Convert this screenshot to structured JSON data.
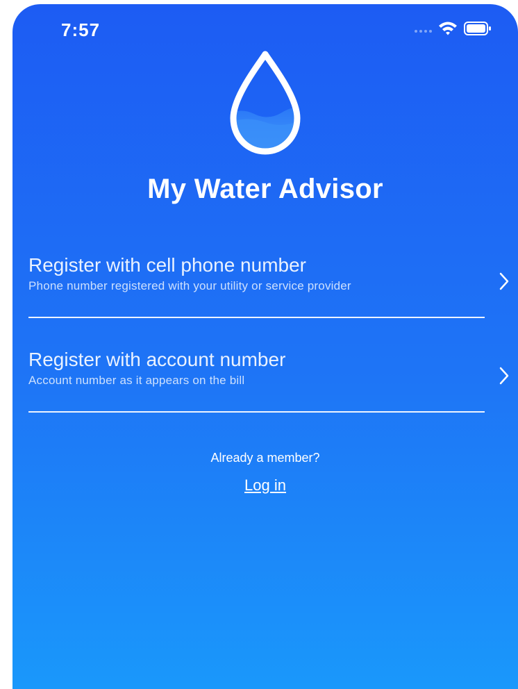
{
  "status_bar": {
    "time": "7:57",
    "icons": [
      "signal-dots-icon",
      "wifi-icon",
      "battery-icon"
    ]
  },
  "app": {
    "logo_icon": "water-drop-icon",
    "title": "My Water Advisor"
  },
  "options": [
    {
      "title": "Register with cell phone number",
      "subtitle": "Phone number registered with your utility or service provider",
      "icon": "chevron-right-icon"
    },
    {
      "title": "Register with account number",
      "subtitle": "Account number as it appears on the bill",
      "icon": "chevron-right-icon"
    }
  ],
  "login": {
    "prompt": "Already a member?",
    "link_label": "Log in"
  },
  "colors": {
    "gradient_top": "#1d5cf3",
    "gradient_bottom": "#1a98fb",
    "text": "#ffffff"
  }
}
